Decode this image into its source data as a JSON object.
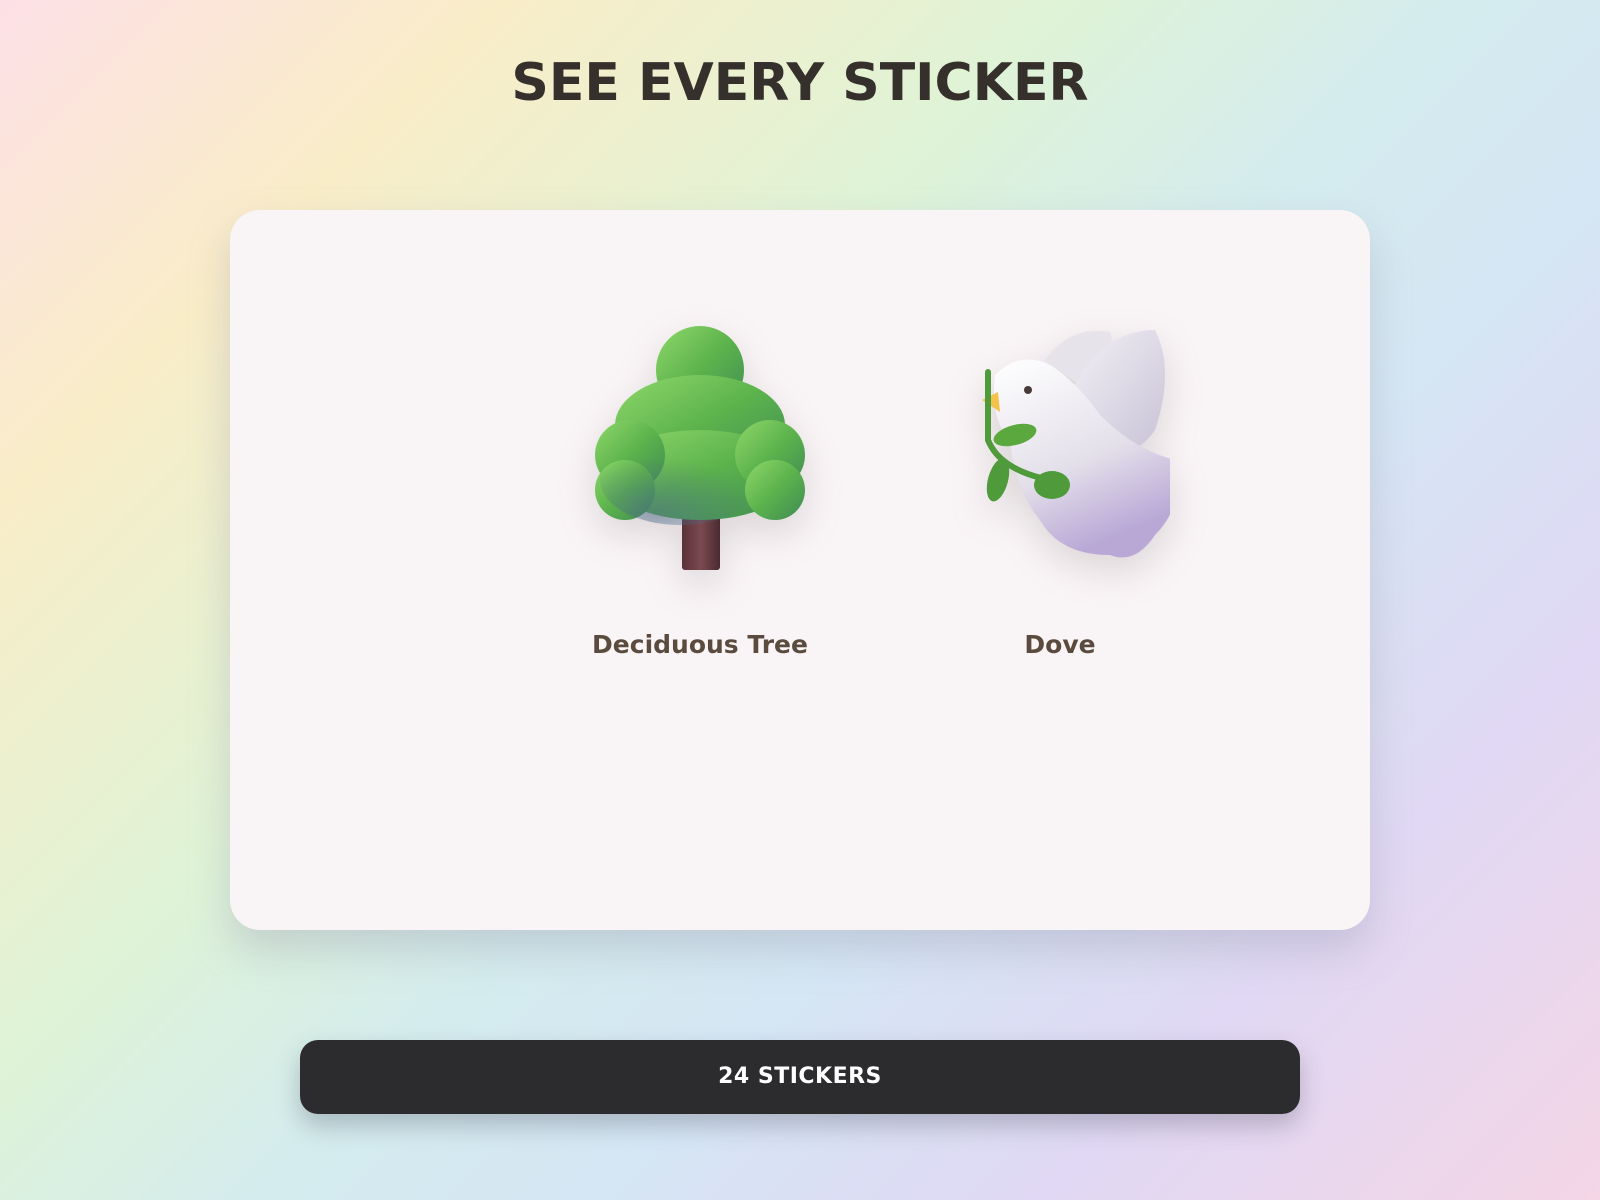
{
  "header": {
    "title": "SEE EVERY STICKER"
  },
  "stickers": [
    {
      "label": "Deciduous Tree",
      "icon": "deciduous-tree-icon"
    },
    {
      "label": "Dove",
      "icon": "dove-icon"
    }
  ],
  "footer": {
    "count_label": "24 STICKERS"
  },
  "colors": {
    "title": "#35302b",
    "card_background": "#f9f4f5",
    "button_background": "#2c2c2f",
    "button_text": "#ffffff",
    "label": "#5a4b3e"
  }
}
